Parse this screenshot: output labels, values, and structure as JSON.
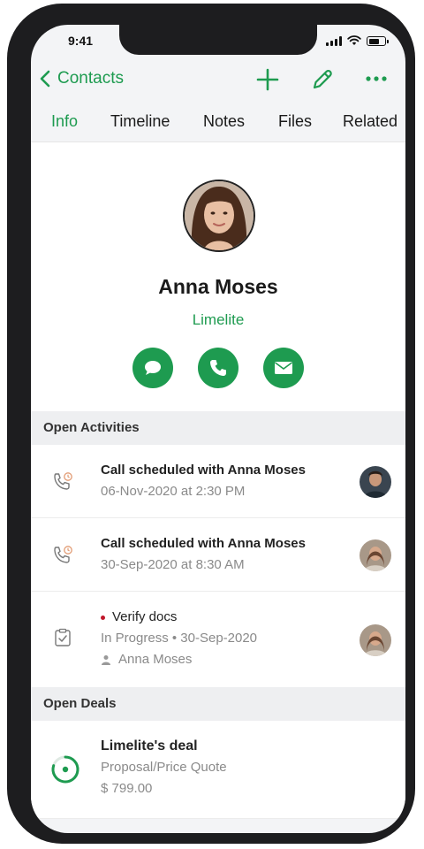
{
  "status_bar": {
    "time": "9:41"
  },
  "navbar": {
    "back_label": "Contacts",
    "icons": {
      "add": "plus-icon",
      "edit": "pencil-icon",
      "more": "more-dots-icon"
    }
  },
  "tabs": [
    {
      "label": "Info",
      "active": true
    },
    {
      "label": "Timeline",
      "active": false
    },
    {
      "label": "Notes",
      "active": false
    },
    {
      "label": "Files",
      "active": false
    },
    {
      "label": "Related",
      "active": false
    }
  ],
  "contact": {
    "name": "Anna Moses",
    "company": "Limelite",
    "actions": [
      "chat-icon",
      "phone-icon",
      "mail-icon"
    ]
  },
  "open_activities": {
    "header": "Open Activities",
    "items": [
      {
        "title": "Call scheduled with Anna Moses",
        "sub": "06-Nov-2020 at 2:30 PM",
        "icon": "call-schedule-icon"
      },
      {
        "title": "Call scheduled with Anna Moses",
        "sub": "30-Sep-2020 at 8:30 AM",
        "icon": "call-schedule-icon"
      },
      {
        "title": "Verify docs",
        "sub": "In Progress • 30-Sep-2020",
        "owner": "Anna Moses",
        "icon": "task-clipboard-icon"
      }
    ]
  },
  "open_deals": {
    "header": "Open Deals",
    "items": [
      {
        "title": "Limelite's deal",
        "stage": "Proposal/Price Quote",
        "amount": "$ 799.00",
        "progress": 0.8
      }
    ]
  },
  "colors": {
    "accent": "#1e9b50",
    "priority": "#c0172b",
    "muted": "#8a8a8a"
  }
}
